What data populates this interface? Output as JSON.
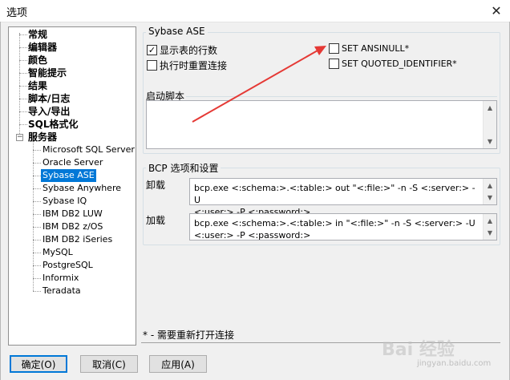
{
  "window": {
    "title": "选项",
    "close_glyph": "✕"
  },
  "tree": {
    "top_items": [
      "常规",
      "编辑器",
      "颜色",
      "智能提示",
      "结果",
      "脚本/日志",
      "导入/导出",
      "SQL格式化"
    ],
    "server_node": "服务器",
    "server_toggle": "−",
    "servers": [
      "Microsoft SQL Server",
      "Oracle Server",
      "Sybase ASE",
      "Sybase Anywhere",
      "Sybase IQ",
      "IBM DB2 LUW",
      "IBM DB2 z/OS",
      "IBM DB2 iSeries",
      "MySQL",
      "PostgreSQL",
      "Informix",
      "Teradata"
    ],
    "selected": "Sybase ASE"
  },
  "sybase_group": {
    "label": "Sybase ASE",
    "show_rowcount": {
      "label": "显示表的行数",
      "checked": true
    },
    "reset_on_exec": {
      "label": "执行时重置连接",
      "checked": false
    },
    "set_ansinull": {
      "label": "SET ANSINULL*",
      "checked": false
    },
    "set_quoted": {
      "label": "SET QUOTED_IDENTIFIER*",
      "checked": false
    },
    "startup_label": "启动脚本",
    "startup_value": ""
  },
  "bcp_group": {
    "label": "BCP 选项和设置",
    "unload_label": "卸载",
    "unload_value": "bcp.exe <:schema:>.<:table:> out \"<:file:>\" -n -S <:server:> -U\n<:user:> -P <:password:>",
    "load_label": "加载",
    "load_value": "bcp.exe <:schema:>.<:table:> in \"<:file:>\" -n -S <:server:> -U\n<:user:> -P <:password:>"
  },
  "footnote": "* - 需要重新打开连接",
  "buttons": {
    "ok": "确定(O)",
    "cancel": "取消(C)",
    "apply": "应用(A)"
  },
  "scroll_up_glyph": "▲",
  "scroll_down_glyph": "▼",
  "check_glyph": "✓",
  "watermark": {
    "main": "Bai 经验",
    "sub": "jingyan.baidu.com"
  },
  "colors": {
    "selection": "#0078d7",
    "annotation_arrow": "#e53935"
  }
}
